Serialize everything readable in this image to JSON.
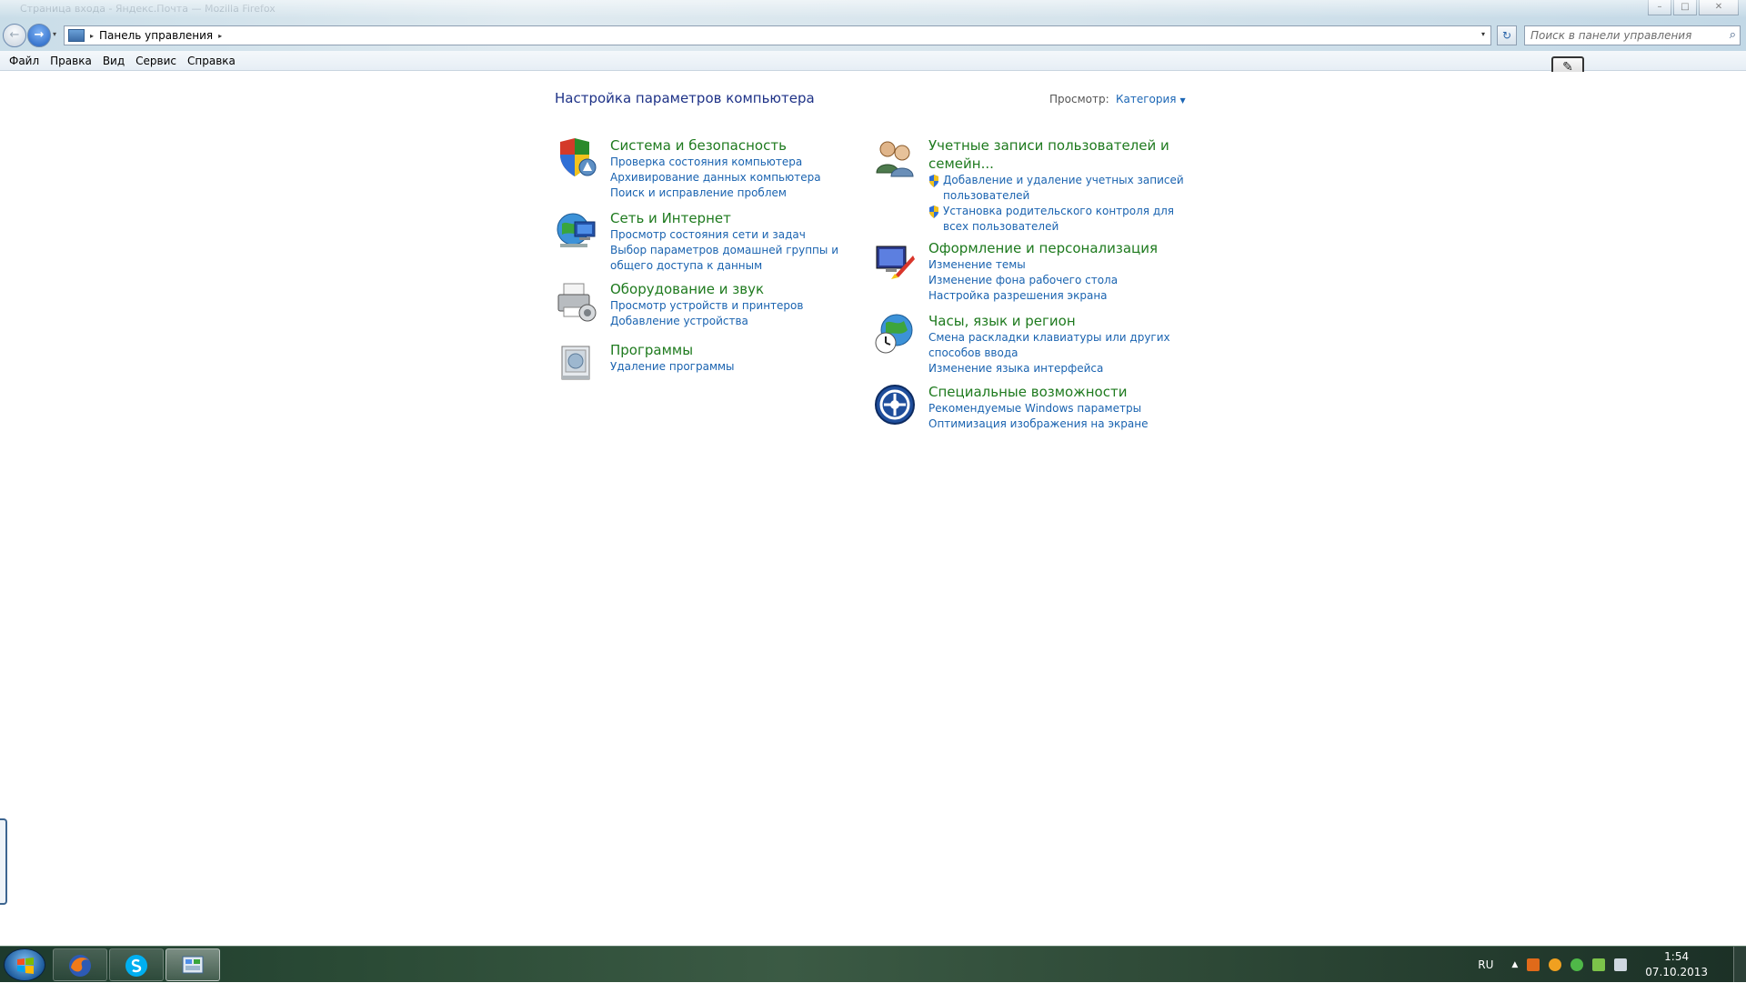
{
  "window": {
    "title": "Страница входа - Яндекс.Почта — Mozilla Firefox",
    "minimize_glyph": "–",
    "maximize_glyph": "□",
    "close_glyph": "✕"
  },
  "nav": {
    "back_glyph": "←",
    "forward_glyph": "→",
    "history_glyph": "▾"
  },
  "address": {
    "crumb_sep": "▸",
    "location": "Панель управления",
    "trail_sep": "▸",
    "dropdown_glyph": "▾",
    "refresh_glyph": "↻"
  },
  "search": {
    "placeholder": "Поиск в панели управления",
    "icon_glyph": "⌕"
  },
  "menu": {
    "items": [
      "Файл",
      "Правка",
      "Вид",
      "Сервис",
      "Справка"
    ]
  },
  "pen_widget_glyph": "✎",
  "main": {
    "title": "Настройка параметров компьютера",
    "view_label": "Просмотр:",
    "view_value": "Категория",
    "view_caret": "▼"
  },
  "categories_left": [
    {
      "title": "Система и безопасность",
      "links": [
        "Проверка состояния компьютера",
        "Архивирование данных компьютера",
        "Поиск и исправление проблем"
      ]
    },
    {
      "title": "Сеть и Интернет",
      "links": [
        "Просмотр состояния сети и задач",
        "Выбор параметров домашней группы и общего доступа к данным"
      ]
    },
    {
      "title": "Оборудование и звук",
      "links": [
        "Просмотр устройств и принтеров",
        "Добавление устройства"
      ]
    },
    {
      "title": "Программы",
      "links": [
        "Удаление программы"
      ]
    }
  ],
  "categories_right": [
    {
      "title": "Учетные записи пользователей и семейн...",
      "links": [
        "Добавление и удаление учетных записей пользователей",
        "Установка родительского контроля для всех пользователей"
      ]
    },
    {
      "title": "Оформление и персонализация",
      "links": [
        "Изменение темы",
        "Изменение фона рабочего стола",
        "Настройка разрешения экрана"
      ]
    },
    {
      "title": "Часы, язык и регион",
      "links": [
        "Смена раскладки клавиатуры или других способов ввода",
        "Изменение языка интерфейса"
      ]
    },
    {
      "title": "Специальные возможности",
      "links": [
        "Рекомендуемые Windows параметры",
        "Оптимизация изображения на экране"
      ]
    }
  ],
  "taskbar": {
    "pinned": [
      "firefox-icon",
      "skype-icon",
      "control-panel-icon"
    ],
    "tray_lang": "RU",
    "tray_arrow": "▲",
    "clock_time": "1:54",
    "clock_date": "07.10.2013"
  }
}
